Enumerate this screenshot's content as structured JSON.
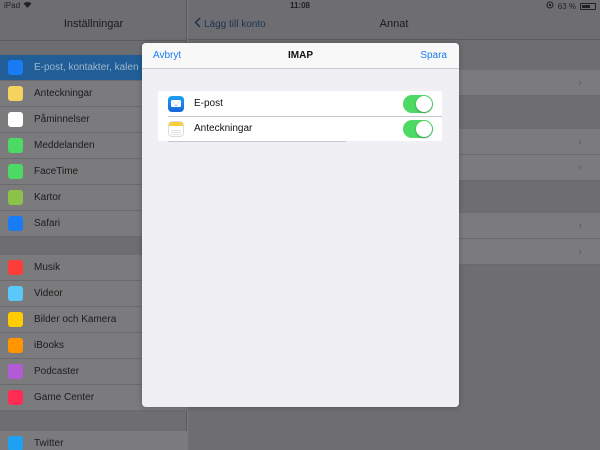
{
  "status_bar": {
    "device": "iPad",
    "time": "11:08",
    "battery": "63 %",
    "battery_level": 0.63
  },
  "sidebar": {
    "title": "Inställningar",
    "items_group1": [
      {
        "label": "E-post, kontakter, kalen",
        "icon": "mail-icon",
        "color": "#1a7cf5",
        "selected": true
      },
      {
        "label": "Anteckningar",
        "icon": "notes-icon",
        "color": "#f4d35e"
      },
      {
        "label": "Påminnelser",
        "icon": "reminders-icon",
        "color": "#ffffff"
      },
      {
        "label": "Meddelanden",
        "icon": "messages-icon",
        "color": "#4cd964"
      },
      {
        "label": "FaceTime",
        "icon": "facetime-icon",
        "color": "#4cd964"
      },
      {
        "label": "Kartor",
        "icon": "maps-icon",
        "color": "#8bc34a"
      },
      {
        "label": "Safari",
        "icon": "safari-icon",
        "color": "#1a7cf5"
      }
    ],
    "items_group2": [
      {
        "label": "Musik",
        "icon": "music-icon",
        "color": "#fc3d39"
      },
      {
        "label": "Videor",
        "icon": "videos-icon",
        "color": "#5ac8fa"
      },
      {
        "label": "Bilder och Kamera",
        "icon": "photos-icon",
        "color": "#ffcc00"
      },
      {
        "label": "iBooks",
        "icon": "ibooks-icon",
        "color": "#ff9500"
      },
      {
        "label": "Podcaster",
        "icon": "podcasts-icon",
        "color": "#b35bd6"
      },
      {
        "label": "Game Center",
        "icon": "gamecenter-icon",
        "color": "#ff2d55"
      }
    ],
    "items_group3": [
      {
        "label": "Twitter",
        "icon": "twitter-icon",
        "color": "#1da1f2"
      }
    ]
  },
  "detail": {
    "back_label": "Lägg till konto",
    "title": "Annat"
  },
  "modal": {
    "cancel_label": "Avbryt",
    "title": "IMAP",
    "save_label": "Spara",
    "rows": [
      {
        "label": "E-post",
        "icon": "mail-icon",
        "on": true
      },
      {
        "label": "Anteckningar",
        "icon": "notes-icon",
        "on": true
      }
    ]
  },
  "colors": {
    "accent": "#1a7cf5",
    "toggle_on": "#4cd964"
  }
}
